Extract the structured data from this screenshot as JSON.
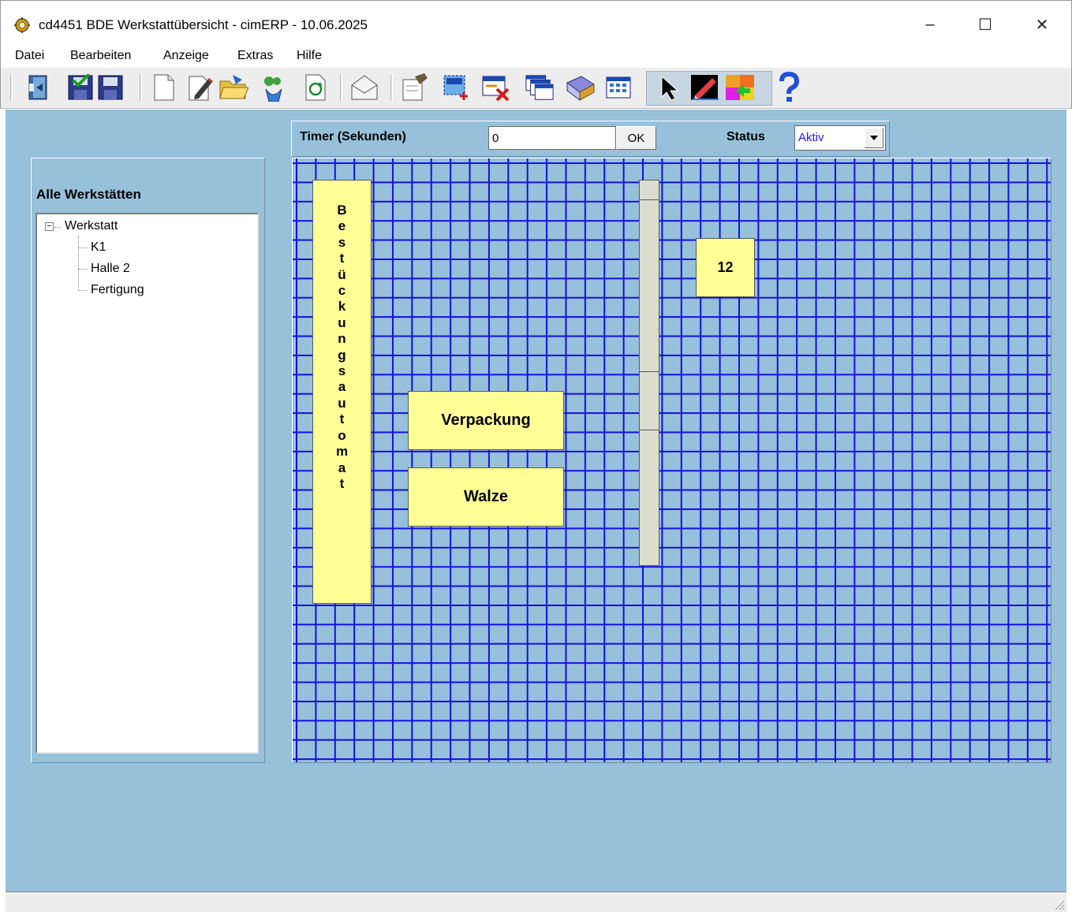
{
  "window": {
    "title": "cd4451 BDE Werkstattübersicht - cimERP - 10.06.2025",
    "controls": {
      "minimize": "–",
      "maximize": "☐",
      "close": "✕"
    }
  },
  "menu": [
    "Datei",
    "Bearbeiten",
    "Anzeige",
    "Extras",
    "Hilfe"
  ],
  "toolbar": {
    "icons": [
      "exit-icon",
      "save-green-icon",
      "save-icon",
      "new-document-icon",
      "edit-icon",
      "open-folder-icon",
      "recycle-icon",
      "refresh-icon",
      "mail-icon",
      "properties-icon",
      "add-area-icon",
      "delete-area-icon",
      "windows-icon",
      "book-icon",
      "grid-icon",
      "select-pointer-icon",
      "draw-pencil-icon",
      "color-fill-icon",
      "help-icon"
    ]
  },
  "header": {
    "timer_label": "Timer (Sekunden)",
    "timer_value": "0",
    "ok_label": "OK",
    "status_label": "Status",
    "status_value": "Aktiv"
  },
  "left_panel": {
    "title": "Alle Werkstätten",
    "tree": {
      "root": "Werkstatt",
      "children": [
        "K1",
        "Halle 2",
        "Fertigung"
      ]
    }
  },
  "workstations": {
    "bestueckung": [
      "B",
      "e",
      "s",
      "t",
      "ü",
      "c",
      "k",
      "u",
      "n",
      "g",
      "s",
      "a",
      "u",
      "t",
      "o",
      "m",
      "a",
      "t"
    ],
    "verpackung": "Verpackung",
    "walze": "Walze",
    "twelve": "12"
  },
  "colors": {
    "client_bg": "#97c0da",
    "grid_line": "#1010e0",
    "box_fill": "#ffff96",
    "segment_fill": "#dcdccf"
  }
}
